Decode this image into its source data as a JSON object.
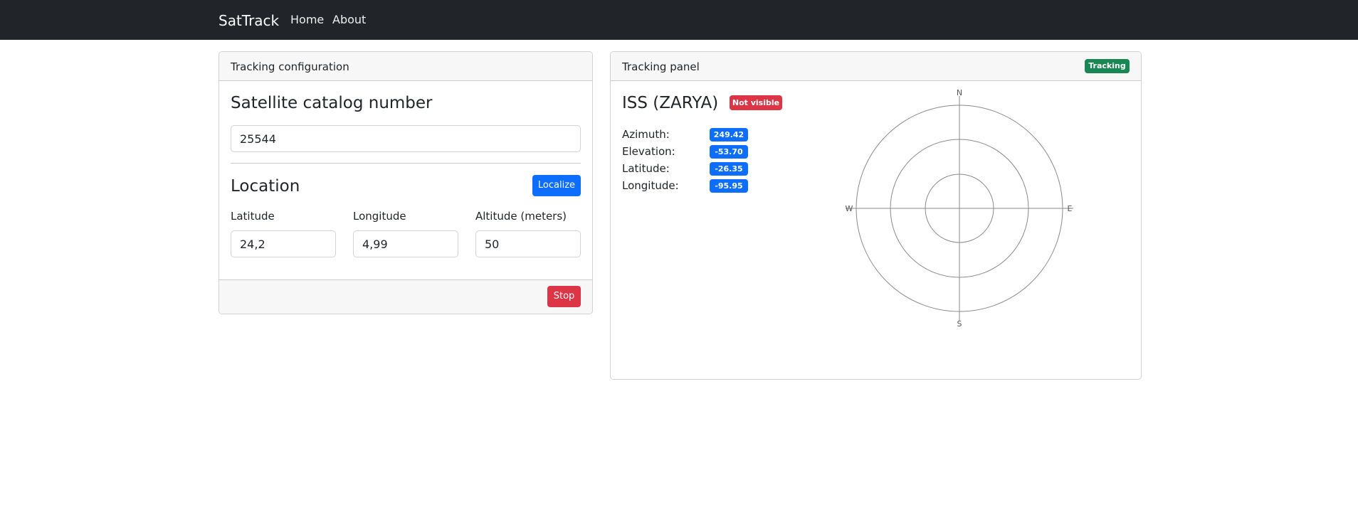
{
  "navbar": {
    "brand": "SatTrack",
    "links": [
      "Home",
      "About"
    ]
  },
  "config": {
    "header": "Tracking configuration",
    "catalog_heading": "Satellite catalog number",
    "catalog_value": "25544",
    "location_heading": "Location",
    "localize_label": "Localize",
    "latitude_label": "Latitude",
    "longitude_label": "Longitude",
    "altitude_label": "Altitude (meters)",
    "latitude_value": "24,2",
    "longitude_value": "4,99",
    "altitude_value": "50",
    "stop_label": "Stop"
  },
  "panel": {
    "header": "Tracking panel",
    "status_badge": "Tracking",
    "satellite_name": "ISS (ZARYA)",
    "visibility_badge": "Not visible",
    "readings": [
      {
        "label": "Azimuth:",
        "value": "249.42"
      },
      {
        "label": "Elevation:",
        "value": "-53.70"
      },
      {
        "label": "Latitude:",
        "value": "-26.35"
      },
      {
        "label": "Longitude:",
        "value": "-95.95"
      }
    ],
    "polar_chart": {
      "directions": {
        "n": "N",
        "e": "E",
        "s": "S",
        "w": "W"
      },
      "rings": 3
    }
  },
  "colors": {
    "navbar": "#212529",
    "primary": "#0d6efd",
    "danger": "#dc3545",
    "success": "#198754"
  }
}
